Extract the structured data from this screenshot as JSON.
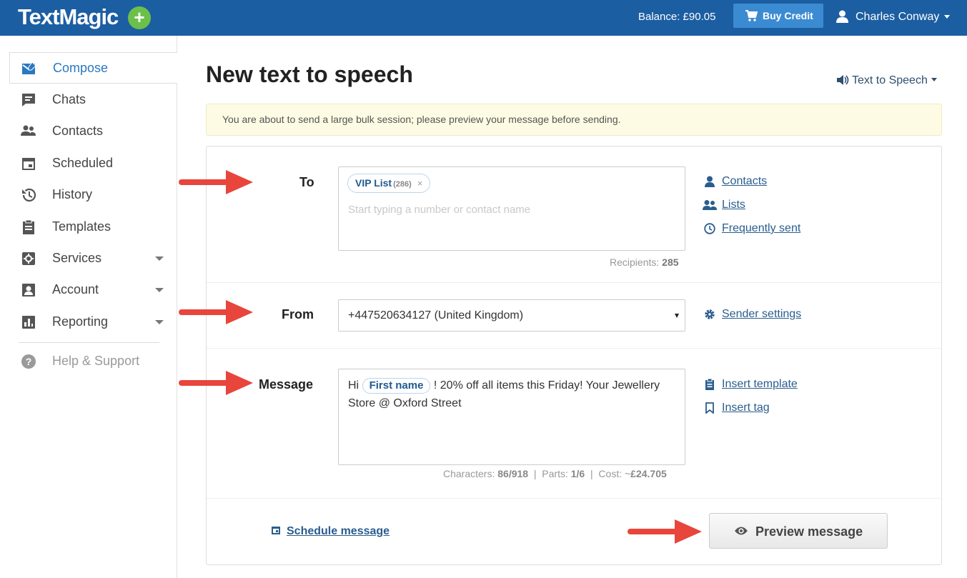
{
  "header": {
    "logo": "TextMagic",
    "logo_plus": "+",
    "balance": "Balance: £90.05",
    "buy_credit": "Buy Credit",
    "user_name": "Charles Conway"
  },
  "sidebar": {
    "items": [
      {
        "label": "Compose",
        "icon": "compose-icon"
      },
      {
        "label": "Chats",
        "icon": "chat-icon"
      },
      {
        "label": "Contacts",
        "icon": "contacts-icon"
      },
      {
        "label": "Scheduled",
        "icon": "calendar-icon"
      },
      {
        "label": "History",
        "icon": "history-icon"
      },
      {
        "label": "Templates",
        "icon": "clipboard-icon"
      },
      {
        "label": "Services",
        "icon": "services-icon"
      },
      {
        "label": "Account",
        "icon": "account-icon"
      },
      {
        "label": "Reporting",
        "icon": "chart-icon"
      }
    ],
    "help": "Help & Support"
  },
  "main": {
    "title": "New text to speech",
    "mode_menu": "Text to Speech",
    "alert": "You are about to send a large bulk session; please preview your message before sending."
  },
  "form": {
    "to_label": "To",
    "chip_name": "VIP List",
    "chip_count": "(286)",
    "chip_remove": "×",
    "to_placeholder": "Start typing a number or contact name",
    "recipients_label": "Recipients:",
    "recipients_value": "285",
    "links_to": {
      "contacts": "Contacts",
      "lists": "Lists",
      "frequent": "Frequently sent"
    },
    "from_label": "From",
    "from_value": "+447520634127 (United Kingdom)",
    "sender_settings": "Sender settings",
    "message_label": "Message",
    "message_pre": "Hi",
    "message_tag": "First name",
    "message_post": "! 20% off all items this Friday! Your Jewellery Store @ Oxford Street",
    "insert_template": "Insert template",
    "insert_tag": "Insert tag",
    "characters_label": "Characters:",
    "characters_value": "86/918",
    "parts_label": "Parts:",
    "parts_value": "1/6",
    "cost_label": "Cost: ~",
    "cost_value": "£24.705",
    "schedule": "Schedule message",
    "preview": "Preview message"
  },
  "colors": {
    "brand": "#1c5ea2",
    "accent": "#3b8bd2",
    "plus_green": "#6cc04a",
    "arrow_red": "#e8453c",
    "link": "#2a5d8f"
  }
}
